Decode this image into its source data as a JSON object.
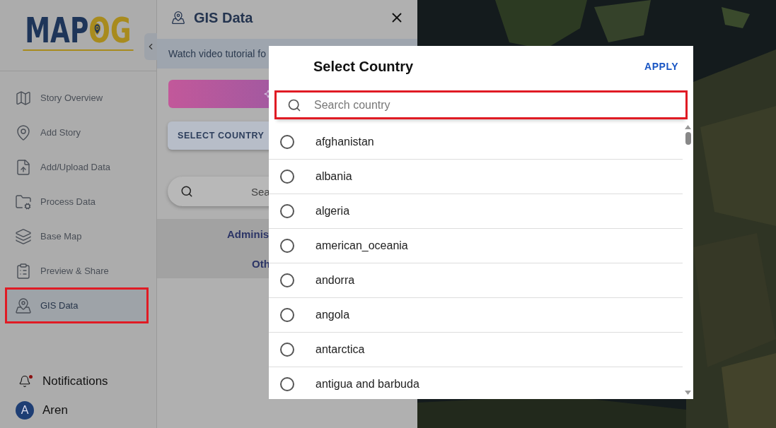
{
  "logo": {
    "primary": "MAP",
    "accent": "OG"
  },
  "sidebar": {
    "items": [
      {
        "label": "Story Overview",
        "selected": false,
        "highlighted": false
      },
      {
        "label": "Add Story",
        "selected": false,
        "highlighted": false
      },
      {
        "label": "Add/Upload Data",
        "selected": false,
        "highlighted": false
      },
      {
        "label": "Process Data",
        "selected": false,
        "highlighted": false
      },
      {
        "label": "Base Map",
        "selected": false,
        "highlighted": false
      },
      {
        "label": "Preview & Share",
        "selected": false,
        "highlighted": false
      },
      {
        "label": "GIS Data",
        "selected": true,
        "highlighted": true
      }
    ],
    "notifications": {
      "label": "Notifications",
      "unread": true
    },
    "user": {
      "initial": "A",
      "name": "Aren"
    }
  },
  "panel": {
    "title": "GIS Data",
    "tutorial": "Watch video tutorial fo",
    "select_button": "SELECT COUNTRY",
    "search_placeholder": "Sea",
    "sections": [
      "Adminis",
      "Oth"
    ]
  },
  "dialog": {
    "title": "Select Country",
    "apply": "APPLY",
    "search": {
      "placeholder": "Search country",
      "highlighted": true
    },
    "countries": [
      {
        "name": "afghanistan",
        "selected": false
      },
      {
        "name": "albania",
        "selected": false
      },
      {
        "name": "algeria",
        "selected": false
      },
      {
        "name": "american_oceania",
        "selected": false
      },
      {
        "name": "andorra",
        "selected": false
      },
      {
        "name": "angola",
        "selected": false
      },
      {
        "name": "antarctica",
        "selected": false
      },
      {
        "name": "antigua and barbuda",
        "selected": false
      }
    ]
  }
}
